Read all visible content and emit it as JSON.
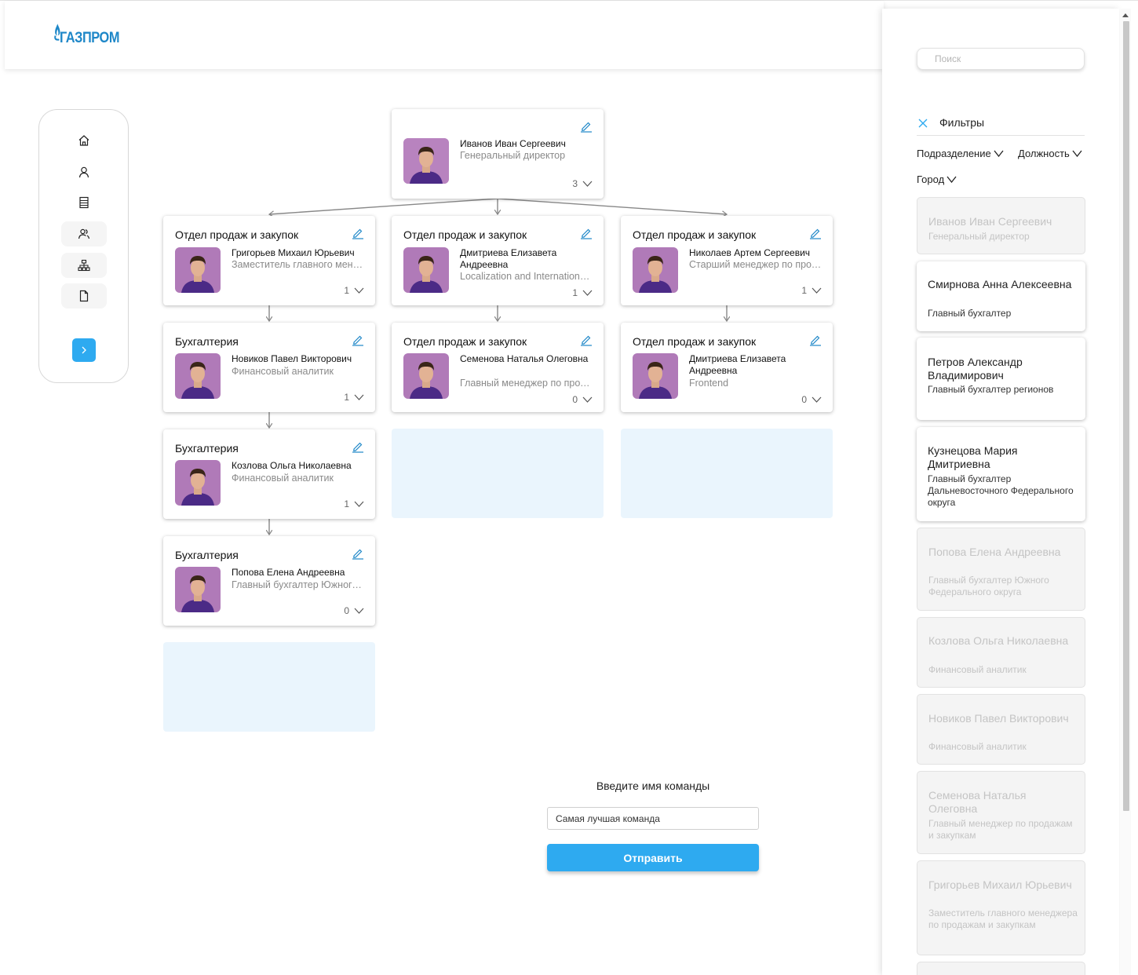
{
  "header": {
    "logo_text": "ГАЗПРОМ",
    "logo_color": "#1e87c8"
  },
  "nav": {
    "items": [
      {
        "icon": "home-icon"
      },
      {
        "icon": "user-icon"
      },
      {
        "icon": "list-icon"
      },
      {
        "icon": "team-icon"
      },
      {
        "icon": "org-structure-icon"
      },
      {
        "icon": "document-icon"
      }
    ],
    "expand_icon": "chevron-right-icon",
    "accent": "#2eaaf0"
  },
  "org": {
    "root": {
      "name": "Иванов Иван Сергеевич",
      "role": "Генеральный директор",
      "count": "3"
    },
    "columns": [
      [
        {
          "dept": "Отдел продаж и закупок",
          "name": "Григорьев Михаил Юрьевич",
          "role": "Заместитель главного менеджера по продажам и закупкам",
          "count": "1"
        },
        {
          "dept": "Бухгалтерия",
          "name": "Новиков Павел Викторович",
          "role": "Финансовый аналитик",
          "count": "1"
        },
        {
          "dept": "Бухгалтерия",
          "name": "Козлова Ольга Николаевна",
          "role": "Финансовый аналитик",
          "count": "1"
        },
        {
          "dept": "Бухгалтерия",
          "name": "Попова Елена Андреевна",
          "role": "Главный бухгалтер Южного Федерального округа",
          "count": "0"
        }
      ],
      [
        {
          "dept": "Отдел продаж и закупок",
          "name": "Дмитриева Елизавета Андреевна",
          "role": "Localization and Internationalization",
          "count": "1"
        },
        {
          "dept": "Отдел продаж и закупок",
          "name": "Семенова Наталья Олеговна",
          "role": "Главный менеджер по продажам и закупкам",
          "count": "0"
        }
      ],
      [
        {
          "dept": "Отдел продаж и закупок",
          "name": "Николаев Артем Сергеевич",
          "role": "Старший менеджер по продажам и закупкам",
          "count": "1"
        },
        {
          "dept": "Отдел продаж и закупок",
          "name": "Дмитриева Елизавета Андреевна",
          "role": "Frontend",
          "count": "0"
        }
      ]
    ]
  },
  "team": {
    "title": "Введите имя команды",
    "input_value": "Самая лучшая команда",
    "submit_label": "Отправить"
  },
  "panel": {
    "search_placeholder": "Поиск",
    "filters_label": "Фильтры",
    "dropdowns": {
      "department": "Подразделение",
      "position": "Должность",
      "city": "Город"
    },
    "people": [
      {
        "name": "Иванов Иван Сергеевич",
        "role": "Генеральный директор",
        "state": "dim"
      },
      {
        "name": "Смирнова Анна Алексеевна",
        "role": "Главный бухгалтер",
        "state": "active"
      },
      {
        "name": "Петров Александр Владимирович",
        "role": "Главный бухгалтер регионов",
        "state": "active"
      },
      {
        "name": "Кузнецова Мария Дмитриевна",
        "role": "Главный бухгалтер Дальневосточного Федерального округа",
        "state": "active"
      },
      {
        "name": "Попова Елена Андреевна",
        "role": "Главный бухгалтер Южного Федерального округа",
        "state": "dim"
      },
      {
        "name": "Козлова Ольга Николаевна",
        "role": "Финансовый аналитик",
        "state": "dim"
      },
      {
        "name": "Новиков Павел Викторович",
        "role": "Финансовый аналитик",
        "state": "dim"
      },
      {
        "name": "Семенова Наталья Олеговна",
        "role": "Главный менеджер по продажам и закупкам",
        "state": "dim"
      },
      {
        "name": "Григорьев Михаил Юрьевич",
        "role": "Заместитель главного менеджера по продажам и закупкам",
        "state": "dim"
      }
    ]
  }
}
